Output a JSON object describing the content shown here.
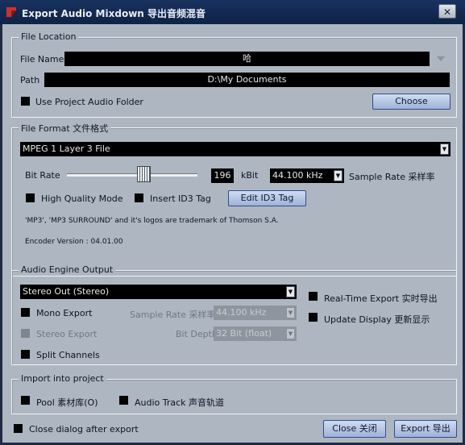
{
  "window": {
    "title": "Export Audio Mixdown 导出音频混音",
    "close_glyph": "✕"
  },
  "file_location": {
    "group_title": "File Location",
    "file_name_label": "File Name",
    "file_name_value": "哈",
    "path_label": "Path",
    "path_value": "D:\\My Documents",
    "use_project_folder_label": "Use Project Audio Folder",
    "choose_label": "Choose"
  },
  "file_format": {
    "group_title": "File Format 文件格式",
    "format_value": "MPEG 1 Layer 3 File",
    "bit_rate_label": "Bit Rate",
    "bit_rate_value": "196",
    "bit_rate_unit": "kBit",
    "bit_rate_level": 0.6,
    "sample_rate_value": "44.100 kHz",
    "sample_rate_label": "Sample Rate 采样率",
    "high_quality_label": "High Quality Mode",
    "insert_id3_label": "Insert ID3 Tag",
    "edit_id3_label": "Edit ID3 Tag",
    "trademark_text": "'MP3', 'MP3 SURROUND' and it's logos are trademark of Thomson S.A.",
    "encoder_version": "Encoder Version : 04.01.00"
  },
  "audio_engine": {
    "group_title": "Audio Engine Output",
    "output_value": "Stereo Out (Stereo)",
    "mono_export_label": "Mono Export",
    "stereo_export_label": "Stereo Export",
    "split_channels_label": "Split Channels",
    "sample_rate_label": "Sample Rate 采样率",
    "sample_rate_value": "44.100 kHz",
    "bit_depth_label": "Bit Depth",
    "bit_depth_value": "32 Bit (float)",
    "realtime_export_label": "Real-Time Export 实时导出",
    "update_display_label": "Update Display 更新显示"
  },
  "import_project": {
    "group_title": "Import into project",
    "pool_label": "Pool 素材库(O)",
    "audio_track_label": "Audio Track 声音轨道"
  },
  "footer": {
    "close_after_export_label": "Close dialog after export",
    "close_label": "Close 关闭",
    "export_label": "Export 导出"
  },
  "colors": {
    "dialog_background": "#aeb6c1",
    "titlebar": "#15305b",
    "field_background": "#000000",
    "button_border": "#2e4f8c"
  }
}
